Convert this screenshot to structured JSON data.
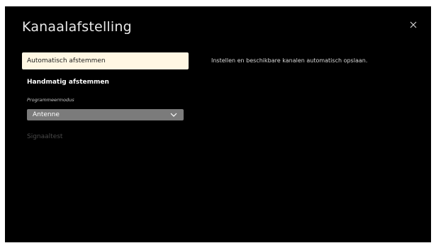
{
  "header": {
    "title": "Kanaalafstelling",
    "close_icon": "close-icon"
  },
  "menu": {
    "items": [
      {
        "label": "Automatisch afstemmen",
        "selected": true
      },
      {
        "label": "Handmatig afstemmen",
        "selected": false
      },
      {
        "label": "Signaaltest",
        "disabled": true
      }
    ]
  },
  "program_mode": {
    "label": "Programmeermodus",
    "value": "Antenne",
    "icon": "chevron-down-icon"
  },
  "description": "Instellen en beschikbare kanalen automatisch opslaan.",
  "colors": {
    "background": "#000000",
    "selected_bg": "#fff7e3",
    "dropdown_bg": "#7b7b7b"
  }
}
